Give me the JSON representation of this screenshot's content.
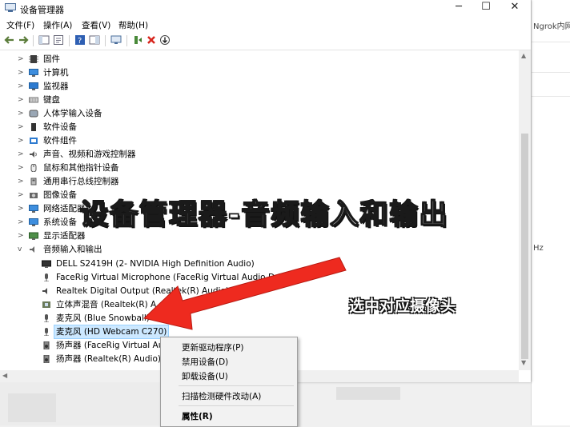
{
  "window": {
    "title": "设备管理器"
  },
  "menubar": [
    "文件(F)",
    "操作(A)",
    "查看(V)",
    "帮助(H)"
  ],
  "background_window": {
    "text_1": "Ngrok内网",
    "text_2": "Hz"
  },
  "tree": [
    {
      "label": "固件",
      "icon": "firmware-icon",
      "expanded": false
    },
    {
      "label": "计算机",
      "icon": "computer-icon",
      "expanded": false
    },
    {
      "label": "监视器",
      "icon": "monitor-icon",
      "expanded": false
    },
    {
      "label": "键盘",
      "icon": "keyboard-icon",
      "expanded": false
    },
    {
      "label": "人体学输入设备",
      "icon": "hid-icon",
      "expanded": false
    },
    {
      "label": "软件设备",
      "icon": "software-device-icon",
      "expanded": false
    },
    {
      "label": "软件组件",
      "icon": "software-component-icon",
      "expanded": false
    },
    {
      "label": "声音、视频和游戏控制器",
      "icon": "sound-icon",
      "expanded": false
    },
    {
      "label": "鼠标和其他指针设备",
      "icon": "mouse-icon",
      "expanded": false
    },
    {
      "label": "通用串行总线控制器",
      "icon": "usb-icon",
      "expanded": false
    },
    {
      "label": "图像设备",
      "icon": "camera-icon",
      "expanded": false
    },
    {
      "label": "网络适配器",
      "icon": "network-icon",
      "expanded": false
    },
    {
      "label": "系统设备",
      "icon": "system-icon",
      "expanded": false
    },
    {
      "label": "显示适配器",
      "icon": "display-adapter-icon",
      "expanded": false
    },
    {
      "label": "音频输入和输出",
      "icon": "audio-io-icon",
      "expanded": true
    }
  ],
  "audio_children": [
    {
      "label": "DELL S2419H (2- NVIDIA High Definition Audio)",
      "icon": "speaker-device-icon"
    },
    {
      "label": "FaceRig Virtual Microphone (FaceRig Virtual Audio Dri",
      "icon": "microphone-icon"
    },
    {
      "label": "Realtek Digital Output (Realtek(R) Audio)",
      "icon": "speaker-device-icon"
    },
    {
      "label": "立体声混音 (Realtek(R) A",
      "icon": "microphone-icon"
    },
    {
      "label": "麦克风 (Blue Snowball)",
      "icon": "microphone-icon"
    },
    {
      "label": "麦克风 (HD Webcam C270)",
      "icon": "microphone-icon",
      "selected": true
    },
    {
      "label": "扬声器 (FaceRig Virtual Au",
      "icon": "speaker-device-icon"
    },
    {
      "label": "扬声器 (Realtek(R) Audio)",
      "icon": "speaker-device-icon"
    }
  ],
  "context_menu": {
    "update_driver": "更新驱动程序(P)",
    "disable": "禁用设备(D)",
    "uninstall": "卸载设备(U)",
    "scan": "扫描检测硬件改动(A)",
    "properties": "属性(R)"
  },
  "annotations": {
    "title": "设备管理器-音频输入和输出",
    "callout": "选中对应摄像头"
  },
  "colors": {
    "arrow": "#ee2a1f",
    "selection": "#cce8ff",
    "accent": "#1565c0"
  }
}
